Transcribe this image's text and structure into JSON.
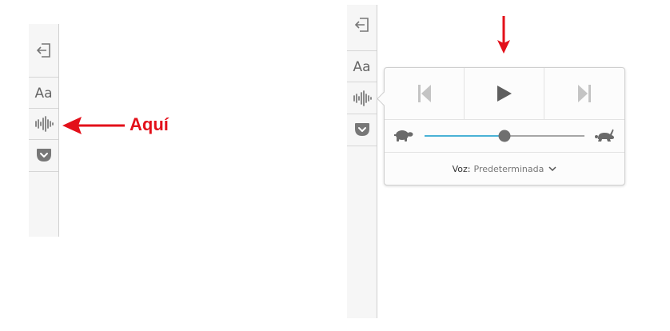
{
  "toolbar": {
    "close_icon": "close-reader-icon",
    "type_controls_label": "Aa",
    "narrate_icon": "narrate-waveform-icon",
    "pocket_icon": "pocket-icon"
  },
  "annotation": {
    "label": "Aquí",
    "color": "#e3101a"
  },
  "narrate_popup": {
    "prev_icon": "skip-previous-icon",
    "play_icon": "play-icon",
    "next_icon": "skip-next-icon",
    "speed_slow_icon": "turtle-icon",
    "speed_fast_icon": "rabbit-icon",
    "speed_value": 0.5,
    "voice_label": "Voz:",
    "voice_value": "Predeterminada",
    "accent": "#4ab2d6"
  }
}
